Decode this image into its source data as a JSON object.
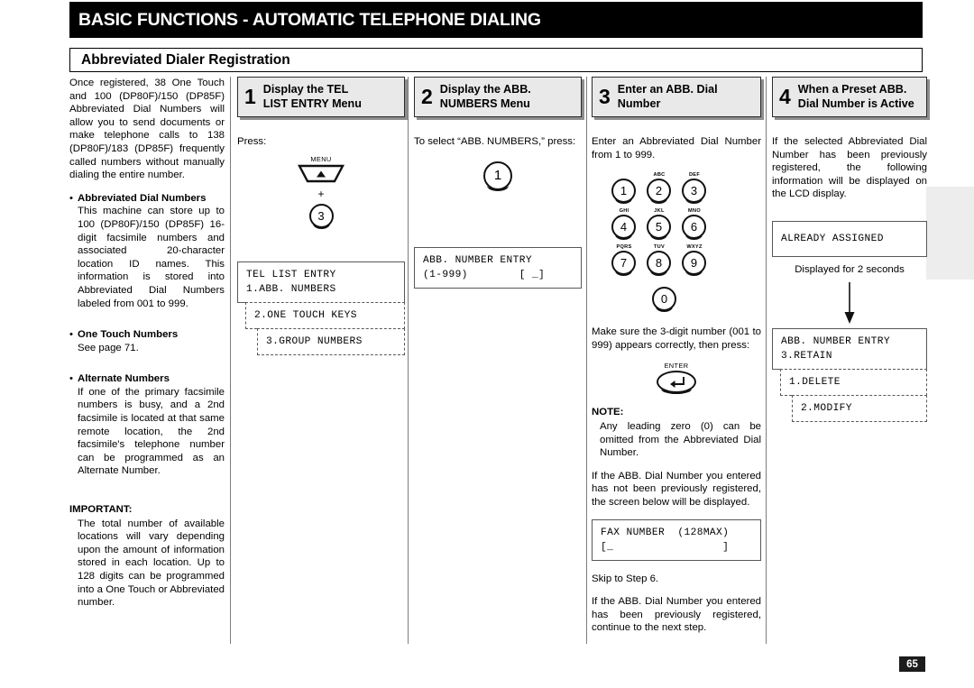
{
  "header": {
    "title": "BASIC FUNCTIONS - AUTOMATIC TELEPHONE DIALING",
    "subtitle": "Abbreviated Dialer Registration"
  },
  "page_number": "65",
  "intro": {
    "paragraph": "Once registered, 38 One Touch and 100 (DP80F)/150 (DP85F) Abbreviated Dial Numbers will allow you to send documents or make telephone calls to 138 (DP80F)/183 (DP85F) frequently called numbers without manually dialing the entire number.",
    "bullets": [
      {
        "heading": "Abbreviated Dial Numbers",
        "body": "This machine can store up to 100 (DP80F)/150 (DP85F) 16-digit facsimile numbers and associated 20-character location ID names. This information is stored into Abbreviated Dial Numbers labeled from 001 to 999."
      },
      {
        "heading": "One Touch Numbers",
        "body": "See page 71."
      },
      {
        "heading": "Alternate Numbers",
        "body": "If one of the primary facsimile numbers is busy, and a 2nd facsimile is located at that same remote location, the 2nd facsimile's telephone number can be programmed as an Alternate Number."
      }
    ],
    "important_label": "IMPORTANT:",
    "important_body": "The total number of available locations will vary depending upon the amount of information stored in each location. Up to 128 digits can be programmed into a One Touch or Abbreviated number."
  },
  "steps": [
    {
      "number": "1",
      "label_line1": "Display the TEL",
      "label_line2": "LIST ENTRY Menu",
      "press_label": "Press:",
      "menu_key_name": "MENU",
      "plus": "+",
      "numeric_key": "3",
      "lcd_primary_line1": "TEL LIST ENTRY",
      "lcd_primary_line2": "1.ABB. NUMBERS",
      "lcd_option2": "2.ONE TOUCH KEYS",
      "lcd_option3": "3.GROUP NUMBERS"
    },
    {
      "number": "2",
      "label_line1": "Display the ABB.",
      "label_line2": "NUMBERS Menu",
      "instruction": "To select “ABB. NUMBERS,” press:",
      "numeric_key": "1",
      "lcd_line1": "ABB. NUMBER ENTRY",
      "lcd_line2": "(1-999)        [ _]"
    },
    {
      "number": "3",
      "label_line1": "Enter an ABB. Dial",
      "label_line2": "Number",
      "instruction": "Enter an Abbreviated Dial Number from 1 to 999.",
      "keypad": [
        {
          "digit": "1",
          "letters": ""
        },
        {
          "digit": "2",
          "letters": "ABC"
        },
        {
          "digit": "3",
          "letters": "DEF"
        },
        {
          "digit": "4",
          "letters": "GHI"
        },
        {
          "digit": "5",
          "letters": "JKL"
        },
        {
          "digit": "6",
          "letters": "MNO"
        },
        {
          "digit": "7",
          "letters": "PQRS"
        },
        {
          "digit": "8",
          "letters": "TUV"
        },
        {
          "digit": "9",
          "letters": "WXYZ"
        },
        {
          "digit": "0",
          "letters": ""
        }
      ],
      "confirm_text": "Make sure the 3-digit number (001 to 999) appears correctly, then press:",
      "enter_key_name": "ENTER",
      "note_label": "NOTE:",
      "note_body": "Any leading zero (0) can be omitted from the Abbreviated Dial Number.",
      "not_registered_text": "If the ABB. Dial Number you entered has not been previously registered, the screen below will be displayed.",
      "lcd_line1": "FAX NUMBER  (128MAX)",
      "lcd_line2": "[_                 ]",
      "skip_text": "Skip to Step 6.",
      "registered_text": "If the ABB. Dial Number you entered has been previously registered, continue to the next step."
    },
    {
      "number": "4",
      "label_line1": "When a Preset ABB.",
      "label_line2": "Dial Number is Active",
      "instruction": "If the selected Abbreviated Dial Number has been  previously registered, the following information will be displayed on the LCD display.",
      "lcd_already": "ALREADY ASSIGNED",
      "caption": "Displayed for 2 seconds",
      "lcd_primary_line1": "ABB. NUMBER ENTRY",
      "lcd_primary_line2": "3.RETAIN",
      "lcd_option1": "1.DELETE",
      "lcd_option2": "2.MODIFY"
    }
  ]
}
